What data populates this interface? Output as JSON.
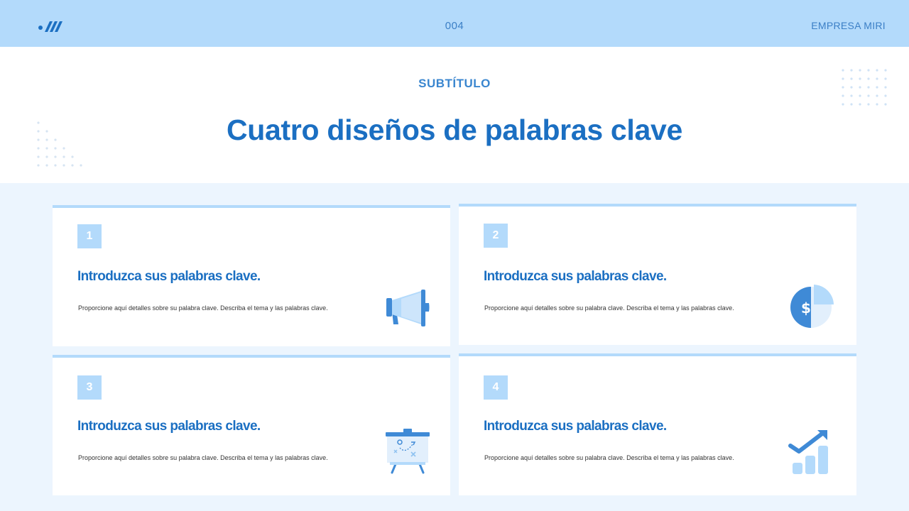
{
  "header": {
    "logo_icon": "brand-logo-icon",
    "page_number": "004",
    "company": "EMPRESA MIRI"
  },
  "hero": {
    "subtitle": "SUBTÍTULO",
    "title": "Cuatro diseños de palabras clave"
  },
  "cards": [
    {
      "number": "1",
      "title": "Introduzca sus palabras clave.",
      "description": "Proporcione aquí detalles sobre su palabra clave.  Describa el tema y las palabras clave.",
      "icon": "megaphone-icon"
    },
    {
      "number": "2",
      "title": "Introduzca sus palabras clave.",
      "description": "Proporcione aquí detalles sobre su palabra clave.  Describa el tema y las palabras clave.",
      "icon": "dollar-pie-chart-icon"
    },
    {
      "number": "3",
      "title": "Introduzca sus palabras clave.",
      "description": "Proporcione aquí detalles sobre su palabra clave.  Describa el tema y las palabras clave.",
      "icon": "strategy-board-icon"
    },
    {
      "number": "4",
      "title": "Introduzca sus palabras clave.",
      "description": "Proporcione aquí detalles sobre su palabra clave.  Describa el tema y las palabras clave.",
      "icon": "growth-bar-chart-icon"
    }
  ],
  "colors": {
    "header_bg": "#b3dafb",
    "accent": "#1b6fc2",
    "light_accent": "#b3dafb",
    "section_bg": "#ecf5fe"
  }
}
